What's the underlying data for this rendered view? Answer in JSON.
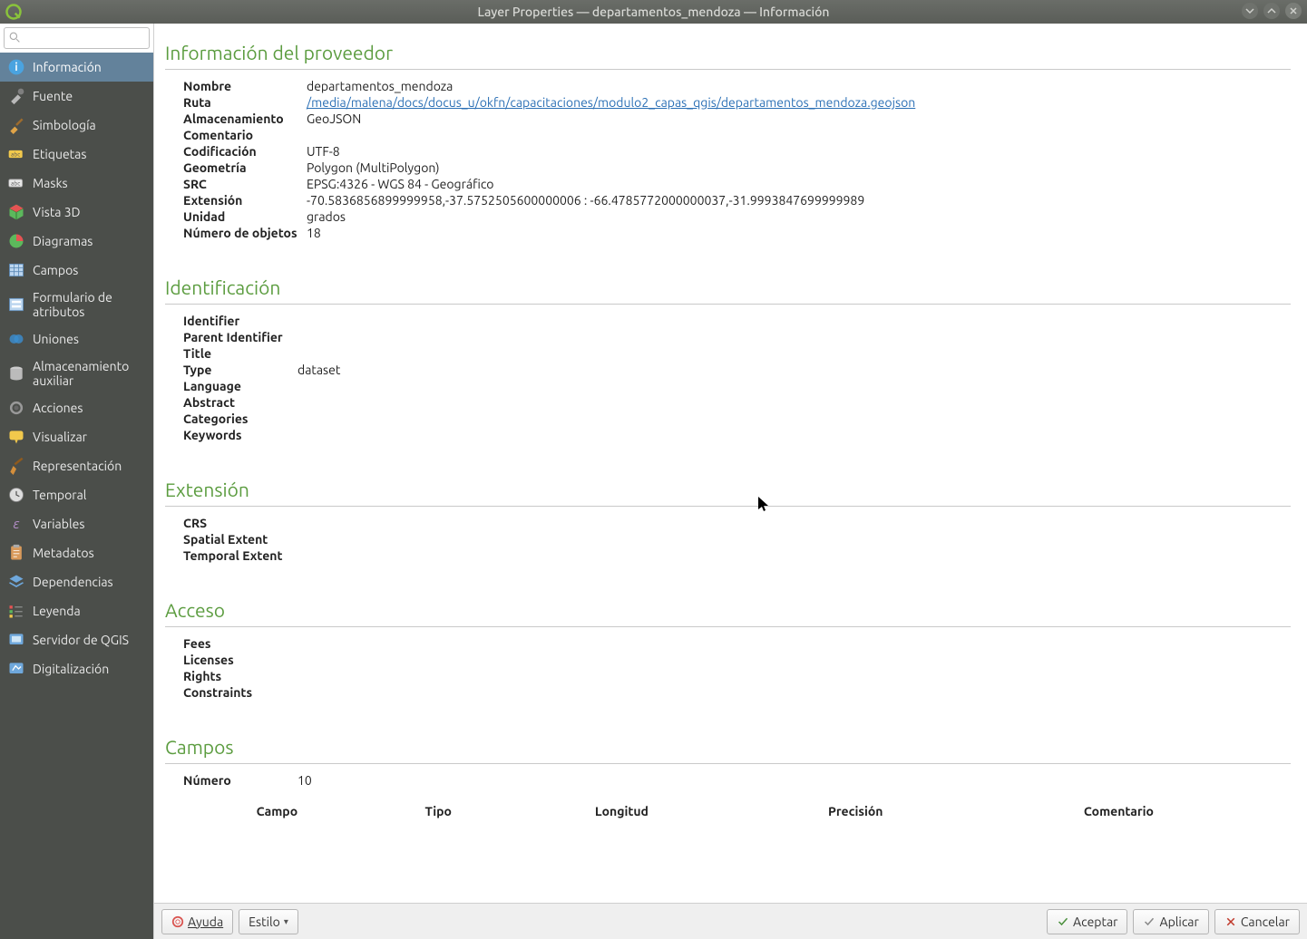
{
  "titlebar": {
    "title": "Layer Properties — departamentos_mendoza — Información"
  },
  "search": {
    "placeholder": ""
  },
  "nav": {
    "items": [
      {
        "label": "Información",
        "selected": true
      },
      {
        "label": "Fuente"
      },
      {
        "label": "Simbología"
      },
      {
        "label": "Etiquetas"
      },
      {
        "label": "Masks"
      },
      {
        "label": "Vista 3D"
      },
      {
        "label": "Diagramas"
      },
      {
        "label": "Campos"
      },
      {
        "label": "Formulario de atributos"
      },
      {
        "label": "Uniones"
      },
      {
        "label": "Almacenamiento auxiliar"
      },
      {
        "label": "Acciones"
      },
      {
        "label": "Visualizar"
      },
      {
        "label": "Representación"
      },
      {
        "label": "Temporal"
      },
      {
        "label": "Variables"
      },
      {
        "label": "Metadatos"
      },
      {
        "label": "Dependencias"
      },
      {
        "label": "Leyenda"
      },
      {
        "label": "Servidor de QGIS"
      },
      {
        "label": "Digitalización"
      }
    ]
  },
  "sections": {
    "proveedor": {
      "heading": "Información del proveedor",
      "rows": {
        "nombre_k": "Nombre",
        "nombre_v": "departamentos_mendoza",
        "ruta_k": "Ruta",
        "ruta_v": "/media/malena/docs/docus_u/okfn/capacitaciones/modulo2_capas_qgis/departamentos_mendoza.geojson",
        "alm_k": "Almacenamiento",
        "alm_v": "GeoJSON",
        "com_k": "Comentario",
        "com_v": "",
        "cod_k": "Codificación",
        "cod_v": "UTF-8",
        "geom_k": "Geometría",
        "geom_v": "Polygon (MultiPolygon)",
        "src_k": "SRC",
        "src_v": "EPSG:4326 - WGS 84 - Geográfico",
        "ext_k": "Extensión",
        "ext_v": "-70.5836856899999958,-37.5752505600000006 : -66.4785772000000037,-31.9993847699999989",
        "uni_k": "Unidad",
        "uni_v": "grados",
        "num_k": "Número de objetos",
        "num_v": "18"
      }
    },
    "ident": {
      "heading": "Identificación",
      "rows": {
        "id_k": "Identifier",
        "id_v": "",
        "pid_k": "Parent Identifier",
        "pid_v": "",
        "tit_k": "Title",
        "tit_v": "",
        "typ_k": "Type",
        "typ_v": "dataset",
        "lan_k": "Language",
        "lan_v": "",
        "abs_k": "Abstract",
        "abs_v": "",
        "cat_k": "Categories",
        "cat_v": "",
        "key_k": "Keywords",
        "key_v": ""
      }
    },
    "extens": {
      "heading": "Extensión",
      "rows": {
        "crs_k": "CRS",
        "crs_v": "",
        "spa_k": "Spatial Extent",
        "spa_v": "",
        "tem_k": "Temporal Extent",
        "tem_v": ""
      }
    },
    "acceso": {
      "heading": "Acceso",
      "rows": {
        "fee_k": "Fees",
        "fee_v": "",
        "lic_k": "Licenses",
        "lic_v": "",
        "rig_k": "Rights",
        "rig_v": "",
        "con_k": "Constraints",
        "con_v": ""
      }
    },
    "campos": {
      "heading": "Campos",
      "numero_k": "Número",
      "numero_v": "10",
      "headers": {
        "campo": "Campo",
        "tipo": "Tipo",
        "longitud": "Longitud",
        "precision": "Precisión",
        "comentario": "Comentario"
      }
    }
  },
  "footer": {
    "ayuda": "Ayuda",
    "estilo": "Estilo",
    "aceptar": "Aceptar",
    "aplicar": "Aplicar",
    "cancelar": "Cancelar"
  }
}
